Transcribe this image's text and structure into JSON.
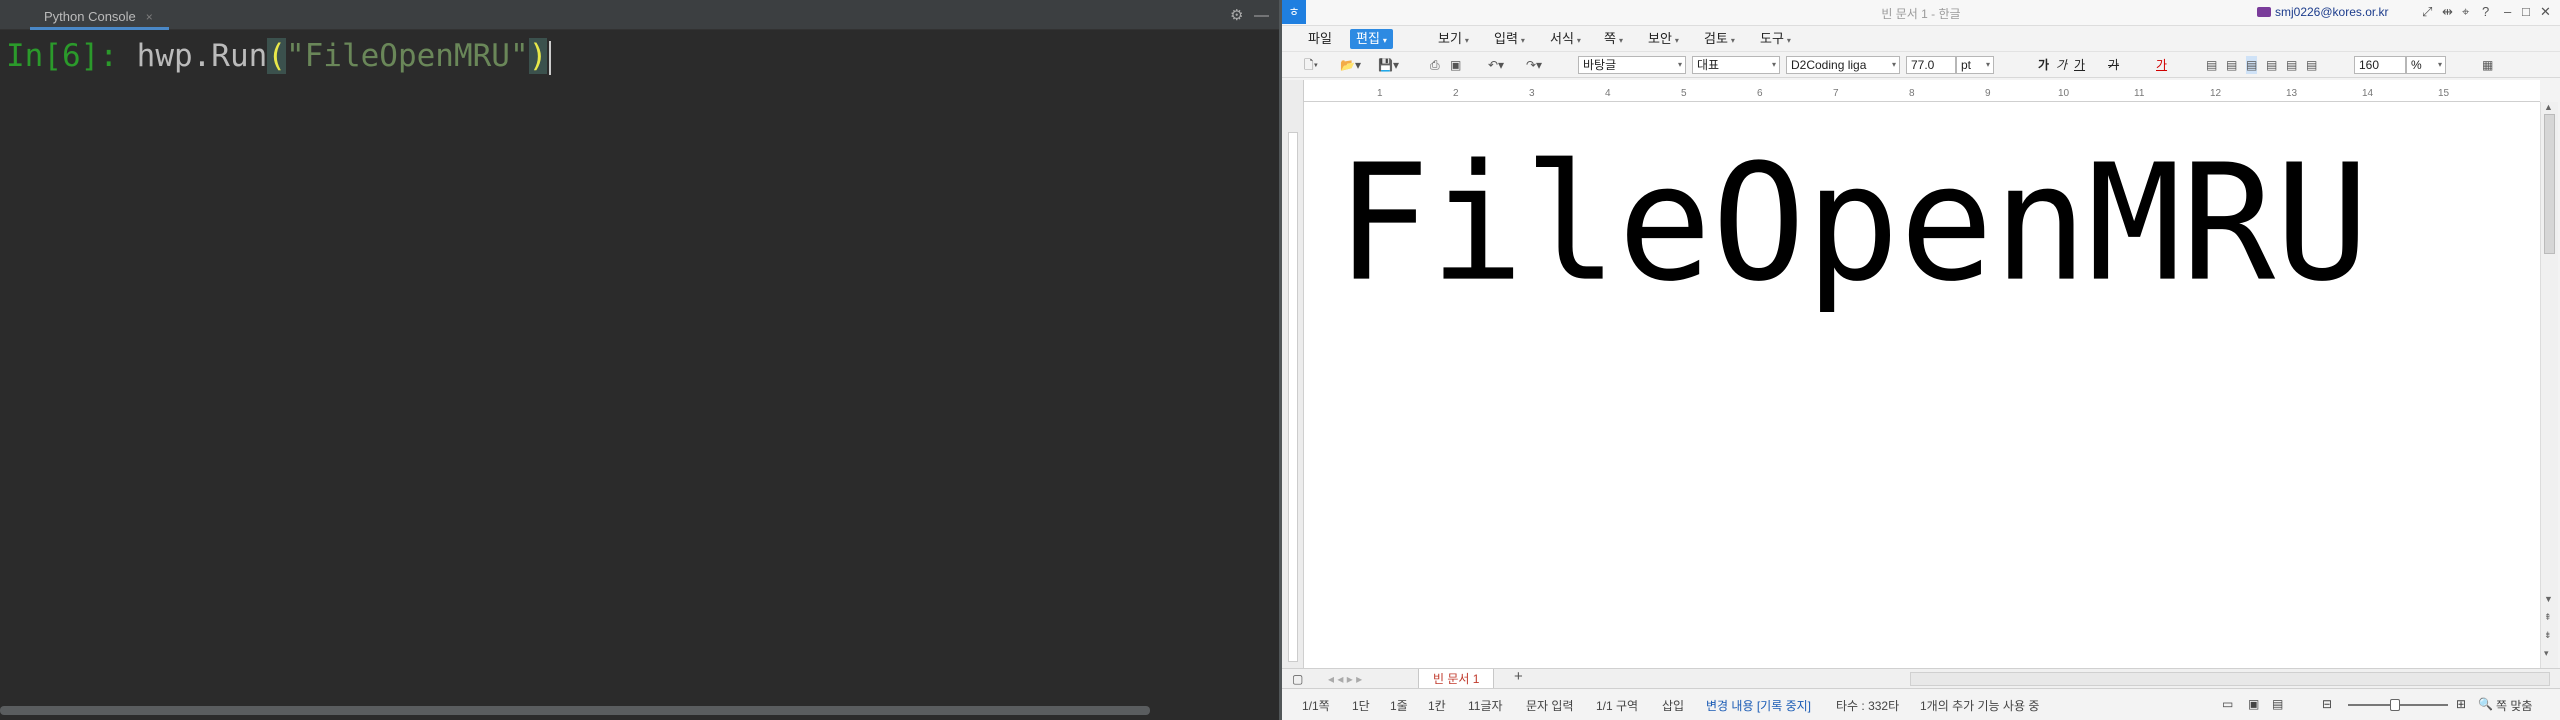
{
  "python_console": {
    "tab_title": "Python Console",
    "tab_close": "×",
    "prompt": "In[6]:",
    "code_prefix": "hwp.Run",
    "paren_open": "(",
    "string_literal": "\"FileOpenMRU\"",
    "paren_close": ")",
    "settings_icon": "gear-icon",
    "minimize_icon": "minimize-icon",
    "colors": {
      "background": "#2b2b2b",
      "prompt": "#2b9a2b",
      "string": "#6a8759",
      "paren_highlight": "#e8e84a"
    }
  },
  "hwp": {
    "window_title": "빈 문서 1 - 한글",
    "account": "smj0226@kores.or.kr",
    "menu": [
      {
        "label": "파일",
        "dropdown": false
      },
      {
        "label": "편집",
        "dropdown": true,
        "active": true
      },
      {
        "label": "보기",
        "dropdown": true
      },
      {
        "label": "입력",
        "dropdown": true
      },
      {
        "label": "서식",
        "dropdown": true
      },
      {
        "label": "쪽",
        "dropdown": true
      },
      {
        "label": "보안",
        "dropdown": true
      },
      {
        "label": "검토",
        "dropdown": true
      },
      {
        "label": "도구",
        "dropdown": true
      }
    ],
    "toolbar": {
      "style": "바탕글",
      "language": "대표",
      "font": "D2Coding liga",
      "font_size": "77.0",
      "font_unit": "pt",
      "bold": "가",
      "italic": "가",
      "underline": "가",
      "strike": "가",
      "font_color": "가",
      "zoom": "160",
      "zoom_unit": "%"
    },
    "ruler_ticks": [
      "1",
      "2",
      "3",
      "4",
      "5",
      "6",
      "7",
      "8",
      "9",
      "10",
      "11",
      "12",
      "13",
      "14",
      "15"
    ],
    "document_text": "FileOpenMRU",
    "doc_tab": "빈 문서 1",
    "add_tab": "+",
    "status": {
      "page": "1/1쪽",
      "column": "1단",
      "line": "1줄",
      "col_pos": "1칸",
      "chars": "11글자",
      "input_mode": "문자 입력",
      "section": "1/1 구역",
      "insert": "삽입",
      "track_changes": "변경 내용 [기록 중지]",
      "typing": "타수 : 332타",
      "feature": "1개의 추가 기능 사용 중",
      "fit": "쪽 맞춤"
    }
  }
}
